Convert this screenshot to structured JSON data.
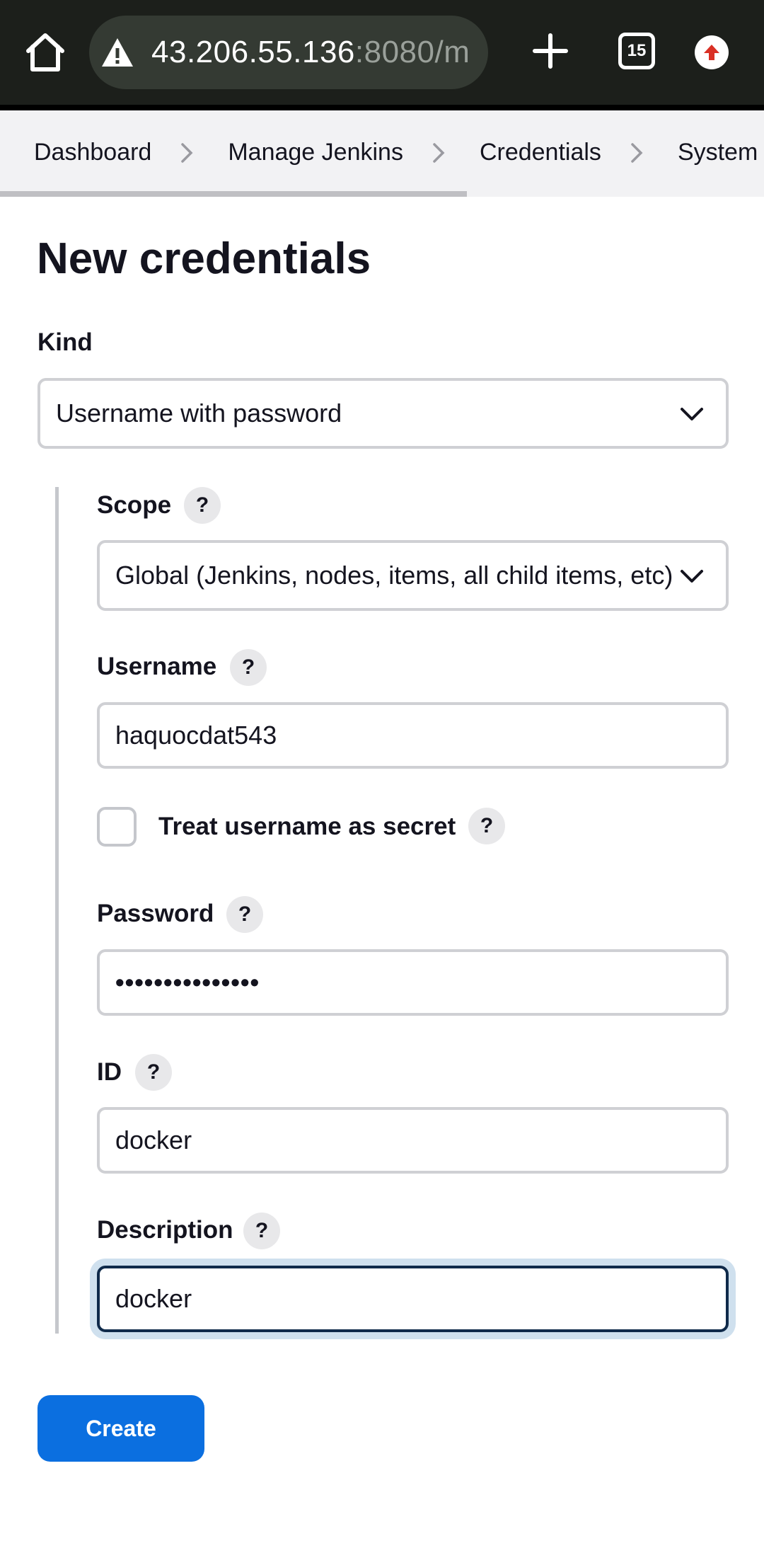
{
  "browser": {
    "url_host": "43.206.55.136",
    "url_rest": ":8080/m",
    "tab_count": "15"
  },
  "breadcrumb": {
    "items": [
      "Dashboard",
      "Manage Jenkins",
      "Credentials",
      "System"
    ]
  },
  "page": {
    "title": "New credentials"
  },
  "form": {
    "kind_label": "Kind",
    "kind_value": "Username with password",
    "scope_label": "Scope",
    "scope_value": "Global (Jenkins, nodes, items, all child items, etc)",
    "username_label": "Username",
    "username_value": "haquocdat543",
    "treat_secret_label": "Treat username as secret",
    "treat_secret_checked": false,
    "password_label": "Password",
    "password_value": "•••••••••••••••",
    "id_label": "ID",
    "id_value": "docker",
    "description_label": "Description",
    "description_value": "docker",
    "help_glyph": "?",
    "create_label": "Create"
  },
  "colors": {
    "primary": "#0b6fe0",
    "chrome_bg": "#1c1f1b",
    "focus_ring": "#cfe0ee"
  }
}
